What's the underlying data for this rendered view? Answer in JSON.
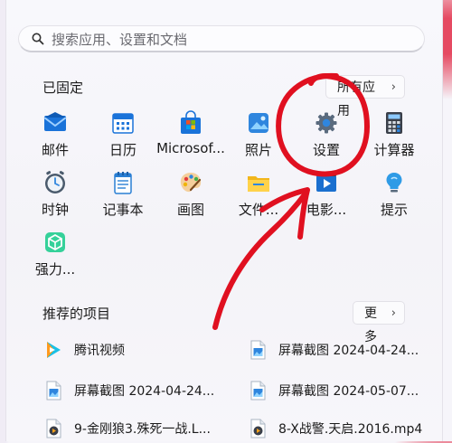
{
  "search": {
    "placeholder": "搜索应用、设置和文档"
  },
  "pinned": {
    "title": "已固定",
    "all_apps_label": "所有应用",
    "apps": [
      {
        "label": "邮件",
        "icon": "mail-icon"
      },
      {
        "label": "日历",
        "icon": "calendar-icon"
      },
      {
        "label": "Microsof...",
        "icon": "microsoft-store-icon"
      },
      {
        "label": "照片",
        "icon": "photos-icon"
      },
      {
        "label": "设置",
        "icon": "settings-gear-icon"
      },
      {
        "label": "计算器",
        "icon": "calculator-icon"
      },
      {
        "label": "时钟",
        "icon": "clock-icon"
      },
      {
        "label": "记事本",
        "icon": "notepad-icon"
      },
      {
        "label": "画图",
        "icon": "paint-icon"
      },
      {
        "label": "文件...",
        "icon": "file-explorer-icon"
      },
      {
        "label": "电影...",
        "icon": "movies-tv-icon"
      },
      {
        "label": "提示",
        "icon": "tips-icon"
      },
      {
        "label": "强力...",
        "icon": "power-automate-icon"
      }
    ]
  },
  "recommended": {
    "title": "推荐的项目",
    "more_label": "更多",
    "items": [
      {
        "label": "腾讯视频",
        "icon": "tencent-video-icon"
      },
      {
        "label": "屏幕截图 2024-04-24...",
        "icon": "image-file-icon"
      },
      {
        "label": "屏幕截图 2024-04-24...",
        "icon": "image-file-icon"
      },
      {
        "label": "屏幕截图 2024-05-07...",
        "icon": "image-file-icon"
      },
      {
        "label": "9-金刚狼3.殊死一战.L...",
        "icon": "video-file-icon"
      },
      {
        "label": "8-X战警.天启.2016.mp4",
        "icon": "video-file-icon"
      }
    ]
  },
  "colors": {
    "annotation_red": "#e01020",
    "accent_blue": "#0a63c9"
  }
}
